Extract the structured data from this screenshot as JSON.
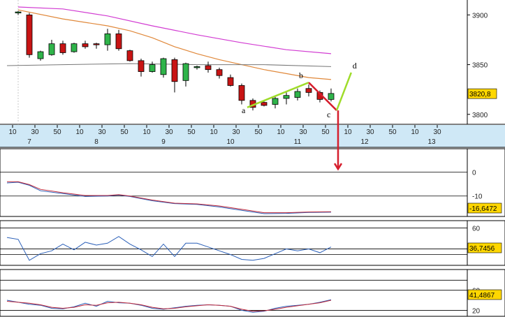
{
  "colors": {
    "up": "#2fb44a",
    "down": "#c81414",
    "ma_long": "#d23cd2",
    "ma_mid": "#e0883a",
    "ma_flat": "#777777",
    "wave_green": "#9fdc2a",
    "wave_red": "#d61e2d",
    "axis_bg": "#cfe8f6",
    "panel_border": "#000000",
    "osc_blue": "#2a5fb8",
    "osc_red": "#c0293b",
    "price_box": "#ffd700"
  },
  "chart_data": [
    {
      "type": "candlestick",
      "panel": "price",
      "ylim": [
        3790,
        3915
      ],
      "yticks": [
        "3900",
        "3850",
        "3800"
      ],
      "ytick_values": [
        3900,
        3850,
        3800
      ],
      "last_price_label": "3820,8",
      "last_price_value": 3820.8,
      "x_index_range": [
        -0.5,
        25.5
      ],
      "candles": [
        {
          "i": 0,
          "o": 3902,
          "h": 3904,
          "l": 3900,
          "c": 3903
        },
        {
          "i": 1,
          "o": 3900,
          "h": 3902,
          "l": 3857,
          "c": 3860
        },
        {
          "i": 2,
          "o": 3856,
          "h": 3864,
          "l": 3854,
          "c": 3863
        },
        {
          "i": 3,
          "o": 3860,
          "h": 3875,
          "l": 3859,
          "c": 3871
        },
        {
          "i": 4,
          "o": 3871,
          "h": 3874,
          "l": 3860,
          "c": 3862
        },
        {
          "i": 5,
          "o": 3863,
          "h": 3872,
          "l": 3862,
          "c": 3871
        },
        {
          "i": 6,
          "o": 3871,
          "h": 3874,
          "l": 3866,
          "c": 3868
        },
        {
          "i": 7,
          "o": 3871,
          "h": 3872,
          "l": 3866,
          "c": 3870
        },
        {
          "i": 8,
          "o": 3870,
          "h": 3886,
          "l": 3864,
          "c": 3881
        },
        {
          "i": 9,
          "o": 3881,
          "h": 3885,
          "l": 3864,
          "c": 3866
        },
        {
          "i": 10,
          "o": 3864,
          "h": 3865,
          "l": 3853,
          "c": 3854
        },
        {
          "i": 11,
          "o": 3854,
          "h": 3856,
          "l": 3838,
          "c": 3843
        },
        {
          "i": 12,
          "o": 3843,
          "h": 3853,
          "l": 3842,
          "c": 3850
        },
        {
          "i": 13,
          "o": 3840,
          "h": 3857,
          "l": 3837,
          "c": 3856
        },
        {
          "i": 14,
          "o": 3855,
          "h": 3857,
          "l": 3822,
          "c": 3833
        },
        {
          "i": 15,
          "o": 3834,
          "h": 3852,
          "l": 3828,
          "c": 3851
        },
        {
          "i": 16,
          "o": 3848,
          "h": 3849,
          "l": 3845,
          "c": 3848
        },
        {
          "i": 17,
          "o": 3849,
          "h": 3853,
          "l": 3842,
          "c": 3845
        },
        {
          "i": 18,
          "o": 3845,
          "h": 3847,
          "l": 3836,
          "c": 3839
        },
        {
          "i": 19,
          "o": 3837,
          "h": 3840,
          "l": 3828,
          "c": 3829
        },
        {
          "i": 20,
          "o": 3829,
          "h": 3831,
          "l": 3810,
          "c": 3814
        },
        {
          "i": 21,
          "o": 3814,
          "h": 3816,
          "l": 3804,
          "c": 3807
        },
        {
          "i": 22,
          "o": 3812,
          "h": 3813,
          "l": 3808,
          "c": 3809
        },
        {
          "i": 23,
          "o": 3810,
          "h": 3818,
          "l": 3806,
          "c": 3816
        },
        {
          "i": 24,
          "o": 3816,
          "h": 3822,
          "l": 3810,
          "c": 3819
        },
        {
          "i": 25,
          "o": 3817,
          "h": 3826,
          "l": 3814,
          "c": 3823
        },
        {
          "i": 26,
          "o": 3826,
          "h": 3830,
          "l": 3818,
          "c": 3822
        },
        {
          "i": 27,
          "o": 3822,
          "h": 3824,
          "l": 3812,
          "c": 3815
        },
        {
          "i": 28,
          "o": 3815,
          "h": 3826,
          "l": 3813,
          "c": 3821
        }
      ],
      "ma_long": [
        [
          0,
          3908
        ],
        [
          4,
          3906
        ],
        [
          8,
          3899
        ],
        [
          12,
          3889
        ],
        [
          16,
          3880
        ],
        [
          20,
          3872
        ],
        [
          24,
          3865
        ],
        [
          28,
          3861
        ]
      ],
      "ma_mid": [
        [
          0,
          3905
        ],
        [
          4,
          3896
        ],
        [
          8,
          3889
        ],
        [
          10,
          3884
        ],
        [
          12,
          3877
        ],
        [
          14,
          3868
        ],
        [
          16,
          3861
        ],
        [
          18,
          3855
        ],
        [
          20,
          3850
        ],
        [
          22,
          3845
        ],
        [
          24,
          3841
        ],
        [
          26,
          3837
        ],
        [
          28,
          3835
        ]
      ],
      "ma_flat": [
        [
          -1,
          3849
        ],
        [
          4,
          3850
        ],
        [
          10,
          3851
        ],
        [
          16,
          3850
        ],
        [
          22,
          3850
        ],
        [
          28,
          3848
        ]
      ],
      "wave_points": {
        "a": {
          "i": 20.5,
          "p": 3807,
          "label": "a"
        },
        "b": {
          "i": 26,
          "p": 3832,
          "label": "b"
        },
        "c": {
          "i": 28.5,
          "p": 3804,
          "label": "c"
        },
        "d": {
          "i": 29.8,
          "p": 3842,
          "label": "d"
        }
      },
      "arrow_target_p": 3745
    },
    {
      "type": "line",
      "panel": "oscillator-1",
      "ylim": [
        -18,
        4
      ],
      "yticks": [
        "0",
        "-10"
      ],
      "ytick_values": [
        0,
        -10
      ],
      "last_value_label": "-16,6472",
      "series": [
        {
          "key": "blue",
          "values": [
            [
              -1,
              -4.5
            ],
            [
              0,
              -4.2
            ],
            [
              1,
              -5.5
            ],
            [
              2,
              -7.8
            ],
            [
              4,
              -9.0
            ],
            [
              6,
              -10.2
            ],
            [
              8,
              -10.0
            ],
            [
              9,
              -9.6
            ],
            [
              10,
              -10.2
            ],
            [
              12,
              -12.0
            ],
            [
              14,
              -13.2
            ],
            [
              16,
              -13.5
            ],
            [
              18,
              -14.6
            ],
            [
              20,
              -16.0
            ],
            [
              22,
              -17.4
            ],
            [
              24,
              -17.3
            ],
            [
              26,
              -16.9
            ],
            [
              28,
              -16.8
            ]
          ]
        },
        {
          "key": "red",
          "values": [
            [
              -1,
              -4.0
            ],
            [
              0,
              -4.0
            ],
            [
              1,
              -5.2
            ],
            [
              2,
              -7.2
            ],
            [
              4,
              -8.6
            ],
            [
              6,
              -9.8
            ],
            [
              8,
              -9.8
            ],
            [
              9,
              -9.4
            ],
            [
              10,
              -10.0
            ],
            [
              12,
              -11.7
            ],
            [
              14,
              -13.0
            ],
            [
              16,
              -13.3
            ],
            [
              18,
              -14.2
            ],
            [
              20,
              -15.6
            ],
            [
              22,
              -17.0
            ],
            [
              24,
              -17.0
            ],
            [
              26,
              -16.7
            ],
            [
              28,
              -16.6
            ]
          ]
        }
      ]
    },
    {
      "type": "line",
      "panel": "oscillator-2",
      "ylim": [
        20,
        64
      ],
      "yticks": [
        "60"
      ],
      "ytick_values": [
        60
      ],
      "last_value_label": "36,7456",
      "hlines": [
        32,
        38
      ],
      "series": [
        {
          "key": "blue",
          "values": [
            [
              -1,
              50
            ],
            [
              0,
              48
            ],
            [
              1,
              26
            ],
            [
              2,
              33
            ],
            [
              3,
              36
            ],
            [
              4,
              43
            ],
            [
              5,
              37
            ],
            [
              6,
              45
            ],
            [
              7,
              42
            ],
            [
              8,
              44
            ],
            [
              9,
              51
            ],
            [
              10,
              43
            ],
            [
              11,
              37
            ],
            [
              12,
              30
            ],
            [
              13,
              43
            ],
            [
              14,
              30
            ],
            [
              15,
              44
            ],
            [
              16,
              44
            ],
            [
              17,
              40
            ],
            [
              18,
              36
            ],
            [
              19,
              32
            ],
            [
              20,
              27
            ],
            [
              21,
              26
            ],
            [
              22,
              28
            ],
            [
              23,
              33
            ],
            [
              24,
              38
            ],
            [
              25,
              36
            ],
            [
              26,
              38
            ],
            [
              27,
              34
            ],
            [
              28,
              40
            ]
          ]
        }
      ]
    },
    {
      "type": "line",
      "panel": "oscillator-3",
      "ylim": [
        8,
        86
      ],
      "yticks": [
        "60",
        "20"
      ],
      "ytick_values": [
        60,
        20
      ],
      "last_value_label": "41,4867",
      "hlines": [
        20,
        80
      ],
      "series": [
        {
          "key": "blue",
          "values": [
            [
              -1,
              40
            ],
            [
              0,
              36
            ],
            [
              1,
              32
            ],
            [
              2,
              30
            ],
            [
              3,
              24
            ],
            [
              4,
              23
            ],
            [
              5,
              27
            ],
            [
              6,
              34
            ],
            [
              7,
              28
            ],
            [
              8,
              38
            ],
            [
              9,
              35
            ],
            [
              10,
              34
            ],
            [
              11,
              30
            ],
            [
              12,
              24
            ],
            [
              13,
              22
            ],
            [
              14,
              25
            ],
            [
              15,
              28
            ],
            [
              16,
              30
            ],
            [
              17,
              31
            ],
            [
              18,
              30
            ],
            [
              19,
              28
            ],
            [
              20,
              20
            ],
            [
              21,
              16
            ],
            [
              22,
              18
            ],
            [
              23,
              24
            ],
            [
              24,
              28
            ],
            [
              25,
              30
            ],
            [
              26,
              32
            ],
            [
              27,
              36
            ],
            [
              28,
              41
            ]
          ]
        },
        {
          "key": "red",
          "values": [
            [
              -1,
              38
            ],
            [
              0,
              36
            ],
            [
              1,
              34
            ],
            [
              2,
              31
            ],
            [
              3,
              26
            ],
            [
              4,
              24
            ],
            [
              5,
              26
            ],
            [
              6,
              31
            ],
            [
              7,
              30
            ],
            [
              8,
              35
            ],
            [
              9,
              36
            ],
            [
              10,
              34
            ],
            [
              11,
              31
            ],
            [
              12,
              26
            ],
            [
              13,
              23
            ],
            [
              14,
              24
            ],
            [
              15,
              27
            ],
            [
              16,
              29
            ],
            [
              17,
              31
            ],
            [
              18,
              30
            ],
            [
              19,
              28
            ],
            [
              20,
              22
            ],
            [
              21,
              18
            ],
            [
              22,
              19
            ],
            [
              23,
              22
            ],
            [
              24,
              26
            ],
            [
              25,
              29
            ],
            [
              26,
              32
            ],
            [
              27,
              35
            ],
            [
              28,
              40
            ]
          ]
        }
      ]
    }
  ],
  "x_axis": {
    "minor_labels": [
      "50",
      "10",
      "30",
      "50",
      "10",
      "30",
      "50",
      "10",
      "30",
      "50",
      "10",
      "30",
      "50",
      "10",
      "30",
      "50",
      "10",
      "30",
      "50",
      "10",
      "30"
    ],
    "minor_positions": [
      -2.5,
      -0.5,
      1.5,
      3.5,
      5.5,
      7.5,
      9.5,
      11.5,
      13.5,
      15.5,
      17.5,
      19.5,
      21.5,
      23.5,
      25.5,
      27.5,
      29.5,
      31.5,
      33.5,
      35.5,
      37.5
    ],
    "major_labels": [
      "7",
      "8",
      "9",
      "10",
      "11",
      "12",
      "13"
    ],
    "major_positions": [
      1,
      7,
      13,
      19,
      25,
      31,
      37
    ]
  }
}
